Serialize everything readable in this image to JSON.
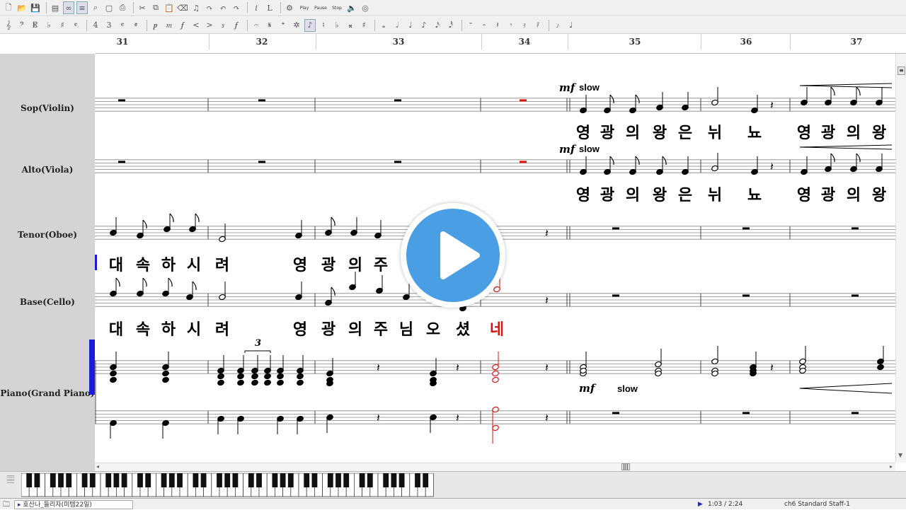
{
  "measures": [
    "31",
    "32",
    "33",
    "34",
    "35",
    "36",
    "37"
  ],
  "instruments": [
    "Sop(Violin)",
    "Alto(Viola)",
    "Tenor(Oboe)",
    "Base(Cello)",
    "Piano(Grand Piano)"
  ],
  "toolbar": {
    "play_label": "Play",
    "pause_label": "Pause",
    "stop_label": "Stop"
  },
  "dynamics": {
    "mf": "mf",
    "slow": "slow"
  },
  "tuplet": "3",
  "lyrics": {
    "sop": [
      "영",
      "광",
      "의",
      "왕",
      "은",
      "뉘",
      "뇨",
      "영",
      "광",
      "의",
      "왕"
    ],
    "alto": [
      "영",
      "광",
      "의",
      "왕",
      "은",
      "뉘",
      "뇨",
      "영",
      "광",
      "의",
      "왕"
    ],
    "tenor": [
      "대",
      "속",
      "하",
      "시",
      "려",
      "영",
      "광",
      "의",
      "주"
    ],
    "bass": [
      "대",
      "속",
      "하",
      "시",
      "려",
      "영",
      "광",
      "의",
      "주",
      "님",
      "오",
      "셨",
      "네"
    ]
  },
  "status": {
    "file": "호산나_들리자(미템22일)",
    "time": "1:03 / 2:24",
    "info": "ch6 Standard  Staff-1"
  },
  "colors": {
    "highlight": "#e01010",
    "play_button": "#4a9ee3",
    "name_panel": "#d4d4d4",
    "staff_line": "#888888"
  }
}
